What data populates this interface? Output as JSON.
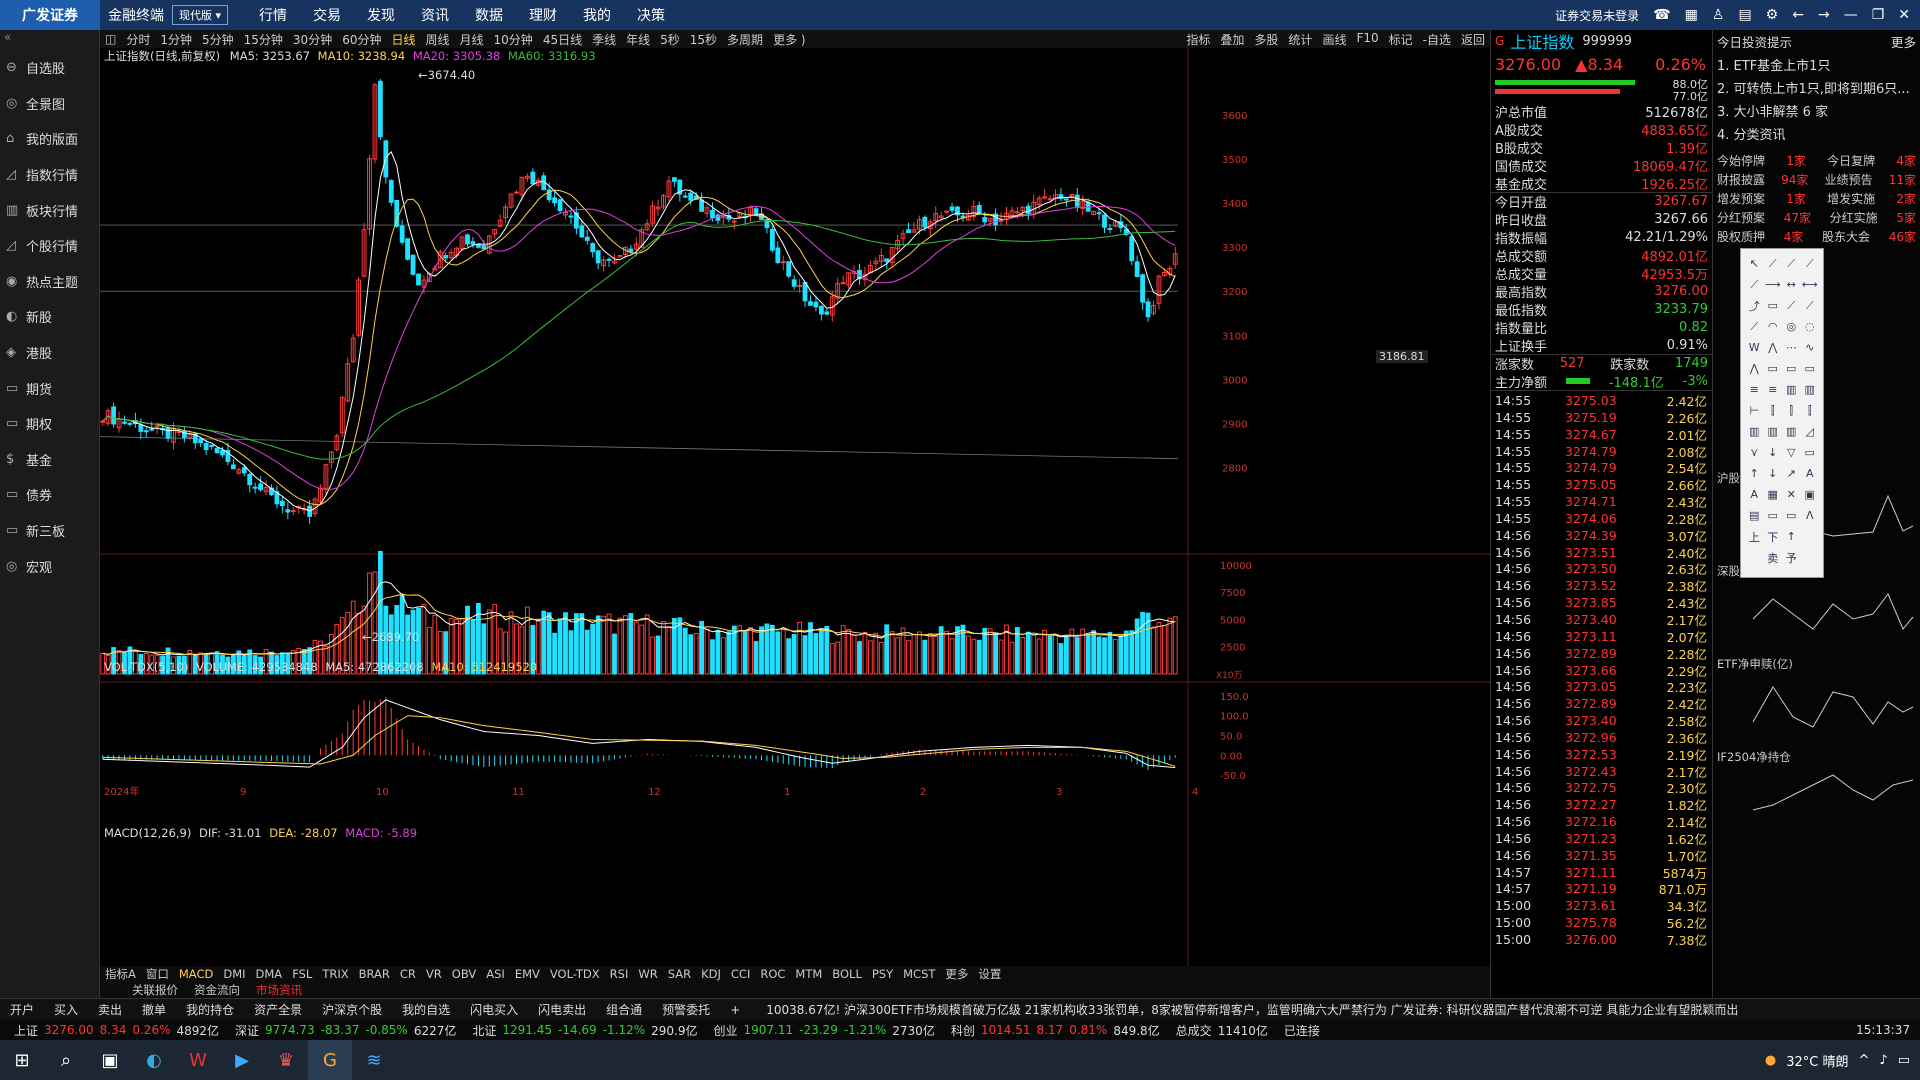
{
  "app": {
    "logo": "广发证券",
    "name": "金融终端",
    "mode": "现代版",
    "menu": [
      "行情",
      "交易",
      "发现",
      "资讯",
      "数据",
      "理财",
      "我的",
      "决策"
    ],
    "login_status": "证券交易未登录"
  },
  "sidebar": {
    "items": [
      {
        "label": "自选股",
        "icon": "star-icon"
      },
      {
        "label": "全景图",
        "icon": "globe-icon"
      },
      {
        "label": "我的版面",
        "icon": "home-icon"
      },
      {
        "label": "指数行情",
        "icon": "chart-icon"
      },
      {
        "label": "板块行情",
        "icon": "grid-icon"
      },
      {
        "label": "个股行情",
        "icon": "chart-icon"
      },
      {
        "label": "热点主题",
        "icon": "target-icon"
      },
      {
        "label": "新股",
        "icon": "new-icon"
      },
      {
        "label": "港股",
        "icon": "hk-icon"
      },
      {
        "label": "期货",
        "icon": "futures-icon"
      },
      {
        "label": "期权",
        "icon": "option-icon"
      },
      {
        "label": "基金",
        "icon": "fund-icon"
      },
      {
        "label": "债券",
        "icon": "bond-icon"
      },
      {
        "label": "新三板",
        "icon": "board-icon"
      },
      {
        "label": "宏观",
        "icon": "macro-icon"
      }
    ]
  },
  "periods": [
    "分时",
    "1分钟",
    "5分钟",
    "15分钟",
    "30分钟",
    "60分钟",
    "日线",
    "周线",
    "月线",
    "10分钟",
    "45日线",
    "季线",
    "年线",
    "5秒",
    "15秒",
    "多周期",
    "更多 )"
  ],
  "active_period": "日线",
  "chart_tools": [
    "指标",
    "叠加",
    "多股",
    "统计",
    "画线",
    "F10",
    "标记",
    "-自选",
    "返回"
  ],
  "kline_header": {
    "title": "上证指数(日线,前复权)",
    "ma5": "MA5: 3253.67",
    "ma10": "MA10: 3238.94",
    "ma20": "MA20: 3305.38",
    "ma60": "MA60: 3316.93"
  },
  "vol_header": {
    "title": "VOL-TDX(5,10)",
    "volume": "VOLUME: 429534848",
    "ma5": "MA5: 472862208",
    "ma10": "MA10: 512419520"
  },
  "macd_header": {
    "title": "MACD(12,26,9)",
    "dif": "DIF: -31.01",
    "dea": "DEA: -28.07",
    "macd": "MACD: -5.89"
  },
  "annotations": {
    "high": "3674.40",
    "low": "2689.70",
    "cursor_price": "3186.81"
  },
  "chart_data": [
    {
      "type": "candlestick",
      "title": "上证指数(日线,前复权)",
      "y_ticks": [
        3600,
        3500,
        3400,
        3300,
        3200,
        3100,
        3000,
        2900,
        2800
      ],
      "ylim": [
        2640,
        3720
      ],
      "x_ticks": [
        "2024年",
        "9",
        "10",
        "11",
        "12",
        "1",
        "2",
        "3",
        "4"
      ],
      "ma_series": [
        {
          "name": "MA5",
          "color": "#ffffff"
        },
        {
          "name": "MA10",
          "color": "#ffd24d"
        },
        {
          "name": "MA20",
          "color": "#e040e0"
        },
        {
          "name": "MA60",
          "color": "#3cbc3c"
        }
      ],
      "close_anchors": [
        [
          0,
          2920
        ],
        [
          5,
          2900
        ],
        [
          10,
          2880
        ],
        [
          15,
          2870
        ],
        [
          20,
          2840
        ],
        [
          25,
          2800
        ],
        [
          30,
          2740
        ],
        [
          35,
          2700
        ],
        [
          38,
          2690
        ],
        [
          40,
          2750
        ],
        [
          43,
          2880
        ],
        [
          46,
          3100
        ],
        [
          48,
          3350
        ],
        [
          50,
          3674
        ],
        [
          52,
          3450
        ],
        [
          55,
          3300
        ],
        [
          58,
          3220
        ],
        [
          62,
          3280
        ],
        [
          66,
          3320
        ],
        [
          70,
          3300
        ],
        [
          74,
          3400
        ],
        [
          78,
          3470
        ],
        [
          82,
          3420
        ],
        [
          86,
          3370
        ],
        [
          90,
          3280
        ],
        [
          94,
          3260
        ],
        [
          97,
          3300
        ],
        [
          101,
          3380
        ],
        [
          104,
          3450
        ],
        [
          108,
          3400
        ],
        [
          112,
          3380
        ],
        [
          116,
          3360
        ],
        [
          120,
          3380
        ],
        [
          124,
          3280
        ],
        [
          128,
          3200
        ],
        [
          132,
          3140
        ],
        [
          136,
          3230
        ],
        [
          140,
          3240
        ],
        [
          144,
          3280
        ],
        [
          148,
          3330
        ],
        [
          152,
          3370
        ],
        [
          156,
          3370
        ],
        [
          160,
          3380
        ],
        [
          164,
          3360
        ],
        [
          168,
          3380
        ],
        [
          172,
          3400
        ],
        [
          176,
          3420
        ],
        [
          180,
          3390
        ],
        [
          184,
          3360
        ],
        [
          188,
          3330
        ],
        [
          190,
          3230
        ],
        [
          192,
          3140
        ],
        [
          194,
          3220
        ],
        [
          197,
          3276
        ]
      ]
    },
    {
      "type": "bar",
      "title": "VOL-TDX(5,10)",
      "y_ticks": [
        10000,
        7500,
        5000,
        2500
      ],
      "unit": "X10万",
      "ylim": [
        0,
        11000
      ],
      "volume_anchors": [
        [
          0,
          2100
        ],
        [
          30,
          2000
        ],
        [
          40,
          2600
        ],
        [
          46,
          5500
        ],
        [
          48,
          8000
        ],
        [
          50,
          10600
        ],
        [
          53,
          6500
        ],
        [
          60,
          5000
        ],
        [
          70,
          5200
        ],
        [
          80,
          5000
        ],
        [
          90,
          4700
        ],
        [
          100,
          4500
        ],
        [
          110,
          4000
        ],
        [
          120,
          3900
        ],
        [
          130,
          3800
        ],
        [
          140,
          3600
        ],
        [
          150,
          3700
        ],
        [
          160,
          3600
        ],
        [
          170,
          3600
        ],
        [
          180,
          3500
        ],
        [
          188,
          3700
        ],
        [
          192,
          5600
        ],
        [
          197,
          4300
        ]
      ]
    },
    {
      "type": "line",
      "title": "MACD(12,26,9)",
      "y_ticks": [
        150.0,
        100.0,
        50.0,
        0.0,
        -50.0
      ],
      "ylim": [
        -70,
        170
      ],
      "dif_anchors": [
        [
          0,
          -10
        ],
        [
          30,
          -25
        ],
        [
          38,
          -30
        ],
        [
          44,
          20
        ],
        [
          48,
          95
        ],
        [
          52,
          140
        ],
        [
          56,
          120
        ],
        [
          62,
          90
        ],
        [
          70,
          60
        ],
        [
          80,
          50
        ],
        [
          90,
          30
        ],
        [
          100,
          40
        ],
        [
          110,
          35
        ],
        [
          120,
          20
        ],
        [
          128,
          -5
        ],
        [
          134,
          -20
        ],
        [
          140,
          -10
        ],
        [
          150,
          10
        ],
        [
          160,
          20
        ],
        [
          170,
          25
        ],
        [
          180,
          20
        ],
        [
          188,
          5
        ],
        [
          192,
          -25
        ],
        [
          197,
          -31
        ]
      ],
      "dea_anchors": [
        [
          0,
          -5
        ],
        [
          30,
          -18
        ],
        [
          40,
          -22
        ],
        [
          46,
          0
        ],
        [
          50,
          50
        ],
        [
          56,
          100
        ],
        [
          62,
          95
        ],
        [
          70,
          75
        ],
        [
          80,
          58
        ],
        [
          90,
          40
        ],
        [
          100,
          38
        ],
        [
          110,
          36
        ],
        [
          120,
          25
        ],
        [
          130,
          5
        ],
        [
          136,
          -8
        ],
        [
          144,
          -5
        ],
        [
          152,
          5
        ],
        [
          160,
          15
        ],
        [
          170,
          20
        ],
        [
          180,
          20
        ],
        [
          188,
          10
        ],
        [
          194,
          -15
        ],
        [
          197,
          -28
        ]
      ]
    }
  ],
  "quote": {
    "name": "上证指数",
    "code": "999999",
    "price": "3276.00",
    "change": "▲8.34",
    "pct": "0.26%",
    "bar1": "88.0亿",
    "bar2": "77.0亿",
    "rows": [
      {
        "k": "沪总市值",
        "v": "512678亿",
        "c": ""
      },
      {
        "k": "A股成交",
        "v": "4883.65亿",
        "c": "r"
      },
      {
        "k": "B股成交",
        "v": "1.39亿",
        "c": "r"
      },
      {
        "k": "国债成交",
        "v": "18069.47亿",
        "c": "r"
      },
      {
        "k": "基金成交",
        "v": "1926.25亿",
        "c": "r"
      },
      {
        "k": "今日开盘",
        "v": "3267.67",
        "c": "r"
      },
      {
        "k": "昨日收盘",
        "v": "3267.66",
        "c": ""
      },
      {
        "k": "指数振幅",
        "v": "42.21/1.29%",
        "c": ""
      },
      {
        "k": "总成交额",
        "v": "4892.01亿",
        "c": "r"
      },
      {
        "k": "总成交量",
        "v": "42953.5万",
        "c": "r"
      },
      {
        "k": "最高指数",
        "v": "3276.00",
        "c": "r"
      },
      {
        "k": "最低指数",
        "v": "3233.79",
        "c": "g"
      },
      {
        "k": "指数量比",
        "v": "0.82",
        "c": "g"
      },
      {
        "k": "上证换手",
        "v": "0.91%",
        "c": ""
      }
    ],
    "up_label": "涨家数",
    "up": "527",
    "down_label": "跌家数",
    "down": "1749",
    "netflow_label": "主力净额",
    "netflow": "-148.1亿",
    "netflow_pct": "-3%"
  },
  "ticks": [
    [
      "14:55",
      "3275.03",
      "2.42亿"
    ],
    [
      "14:55",
      "3275.19",
      "2.26亿"
    ],
    [
      "14:55",
      "3274.67",
      "2.01亿"
    ],
    [
      "14:55",
      "3274.79",
      "2.08亿"
    ],
    [
      "14:55",
      "3274.79",
      "2.54亿"
    ],
    [
      "14:55",
      "3275.05",
      "2.66亿"
    ],
    [
      "14:55",
      "3274.71",
      "2.43亿"
    ],
    [
      "14:55",
      "3274.06",
      "2.28亿"
    ],
    [
      "14:56",
      "3274.39",
      "3.07亿"
    ],
    [
      "14:56",
      "3273.51",
      "2.40亿"
    ],
    [
      "14:56",
      "3273.50",
      "2.63亿"
    ],
    [
      "14:56",
      "3273.52",
      "2.38亿"
    ],
    [
      "14:56",
      "3273.85",
      "2.43亿"
    ],
    [
      "14:56",
      "3273.40",
      "2.17亿"
    ],
    [
      "14:56",
      "3273.11",
      "2.07亿"
    ],
    [
      "14:56",
      "3272.89",
      "2.28亿"
    ],
    [
      "14:56",
      "3273.66",
      "2.29亿"
    ],
    [
      "14:56",
      "3273.05",
      "2.23亿"
    ],
    [
      "14:56",
      "3272.89",
      "2.42亿"
    ],
    [
      "14:56",
      "3273.40",
      "2.58亿"
    ],
    [
      "14:56",
      "3272.96",
      "2.36亿"
    ],
    [
      "14:56",
      "3272.53",
      "2.19亿"
    ],
    [
      "14:56",
      "3272.43",
      "2.17亿"
    ],
    [
      "14:56",
      "3272.75",
      "2.30亿"
    ],
    [
      "14:56",
      "3272.27",
      "1.82亿"
    ],
    [
      "14:56",
      "3272.16",
      "2.14亿"
    ],
    [
      "14:56",
      "3271.23",
      "1.62亿"
    ],
    [
      "14:56",
      "3271.35",
      "1.70亿"
    ],
    [
      "14:57",
      "3271.11",
      "5874万"
    ],
    [
      "14:57",
      "3271.19",
      "871.0万"
    ],
    [
      "15:00",
      "3273.61",
      "34.3亿"
    ],
    [
      "15:00",
      "3275.78",
      "56.2亿"
    ],
    [
      "15:00",
      "3276.00",
      "7.38亿"
    ]
  ],
  "news": {
    "header": "今日投资提示",
    "more": "更多",
    "items": [
      "1. ETF基金上市1只",
      "2. 可转债上市1只,即将到期6只...",
      "3. 大小非解禁 6 家",
      "4. 分类资讯"
    ],
    "stats": [
      [
        "今始停牌",
        "1家",
        "今日复牌",
        "4家"
      ],
      [
        "财报披露",
        "94家",
        "业绩预告",
        "11家"
      ],
      [
        "增发预案",
        "1家",
        "增发实施",
        "2家"
      ],
      [
        "分红预案",
        "47家",
        "分红实施",
        "5家"
      ],
      [
        "股权质押",
        "4家",
        "股东大会",
        "46家"
      ]
    ],
    "mini_charts": [
      "沪股通资金流入(亿)",
      "深股通资金流入(亿)",
      "ETF净申赎(亿)",
      "IF2504净持仓"
    ]
  },
  "indicator_tabs": [
    "指标A",
    "窗口",
    "MACD",
    "DMI",
    "DMA",
    "FSL",
    "TRIX",
    "BRAR",
    "CR",
    "VR",
    "OBV",
    "ASI",
    "EMV",
    "VOL-TDX",
    "RSI",
    "WR",
    "SAR",
    "KDJ",
    "CCI",
    "ROC",
    "MTM",
    "BOLL",
    "PSY",
    "MCST",
    "更多",
    "设置"
  ],
  "sub_tabs": [
    "关联报价",
    "资金流向",
    "市场资讯"
  ],
  "trade_buttons": [
    "开户",
    "买入",
    "卖出",
    "撤单",
    "我的持仓",
    "资产全景",
    "沪深京个股",
    "我的自选",
    "闪电买入",
    "闪电卖出",
    "组合通",
    "预警委托"
  ],
  "ticker_text": "10038.67亿! 沪深300ETF市场规模首破万亿级     21家机构收33张罚单，8家被暂停新增客户，监管明确六大严禁行为     广发证券: 科研仪器国产替代浪潮不可逆 具能力企业有望脱颖而出",
  "status": {
    "sh": "上证",
    "sh_v": "3276.00",
    "sh_c": "8.34",
    "sh_p": "0.26%",
    "sh_amt": "4892亿",
    "sz": "深证",
    "sz_v": "9774.73",
    "sz_c": "-83.37",
    "sz_p": "-0.85%",
    "sz_amt": "6227亿",
    "bj": "北证",
    "bj_v": "1291.45",
    "bj_c": "-14.69",
    "bj_p": "-1.12%",
    "bj_amt": "290.9亿",
    "cy": "创业",
    "cy_v": "1907.11",
    "cy_c": "-23.29",
    "cy_p": "-1.21%",
    "cy_amt": "2730亿",
    "kc": "科创",
    "kc_v": "1014.51",
    "kc_c": "8.17",
    "kc_p": "0.81%",
    "kc_amt": "849.8亿",
    "total": "总成交",
    "total_v": "11410亿",
    "conn": "已连接",
    "time": "15:13:37"
  },
  "taskbar": {
    "weather": "32°C 晴朗"
  }
}
